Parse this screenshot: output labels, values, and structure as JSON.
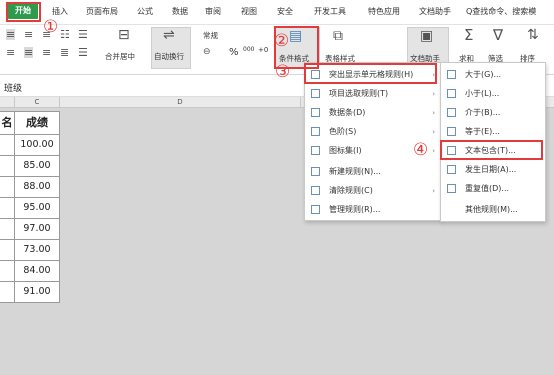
{
  "tabs": {
    "active": "开始",
    "items": [
      "插入",
      "页面布局",
      "公式",
      "数据",
      "审阅",
      "视图",
      "安全",
      "开发工具",
      "特色应用",
      "文档助手"
    ],
    "search": "Q查找命令、搜索模"
  },
  "ribbon": {
    "merge_label": "合并居中",
    "wrap_label": "自动换行",
    "number_format": "常规",
    "cond_format_label": "条件格式",
    "table_style_label": "表格样式",
    "doc_helper_label": "文档助手",
    "sum_label": "求和",
    "filter_label": "筛选",
    "sort_label": "排序",
    "percent_symbol": "%",
    "thousands_symbol": "000"
  },
  "formula_bar": {
    "value": "班级"
  },
  "sheet": {
    "col_c": "C",
    "col_d": "D",
    "header_left": "名",
    "header": "成绩",
    "scores": [
      "100.00",
      "85.00",
      "88.00",
      "95.00",
      "97.00",
      "73.00",
      "84.00",
      "91.00"
    ]
  },
  "main_menu": {
    "items": [
      {
        "label": "突出显示单元格规则(H)",
        "arrow": "›"
      },
      {
        "label": "项目选取规则(T)",
        "arrow": "›"
      },
      {
        "label": "数据条(D)",
        "arrow": "›"
      },
      {
        "label": "色阶(S)",
        "arrow": "›"
      },
      {
        "label": "图标集(I)",
        "arrow": "›"
      },
      {
        "label": "新建规则(N)...",
        "arrow": ""
      },
      {
        "label": "清除规则(C)",
        "arrow": "›"
      },
      {
        "label": "管理规则(R)...",
        "arrow": ""
      }
    ]
  },
  "sub_menu": {
    "items": [
      {
        "label": "大于(G)..."
      },
      {
        "label": "小于(L)..."
      },
      {
        "label": "介于(B)..."
      },
      {
        "label": "等于(E)..."
      },
      {
        "label": "文本包含(T)..."
      },
      {
        "label": "发生日期(A)..."
      },
      {
        "label": "重复值(D)..."
      },
      {
        "label": "其他规则(M)..."
      }
    ]
  },
  "annotations": {
    "n1": "①",
    "n2": "②",
    "n3": "③",
    "n4": "④"
  },
  "colors": {
    "accent_green": "#2e9b4c",
    "highlight_red": "#e23b3b"
  }
}
